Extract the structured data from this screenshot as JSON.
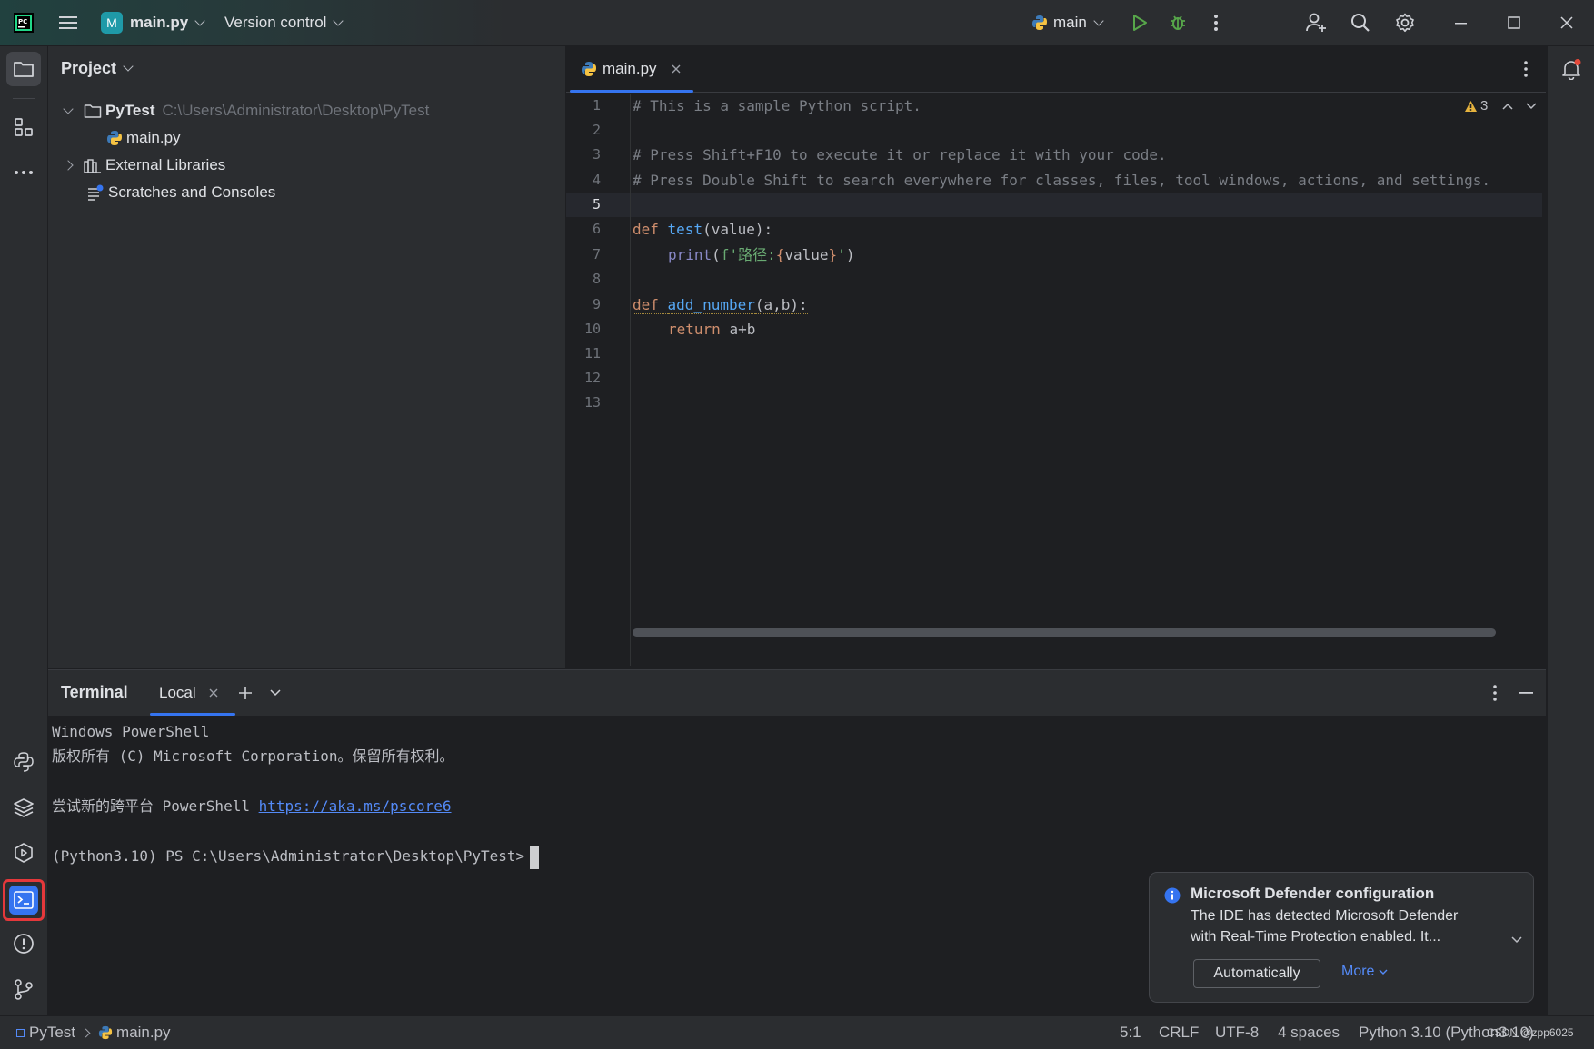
{
  "titlebar": {
    "project_badge": "M",
    "project_name": "main.py",
    "vcs_label": "Version control",
    "run_config": "main"
  },
  "project_panel": {
    "title": "Project",
    "tree": [
      {
        "label": "PyTest",
        "path": "C:\\Users\\Administrator\\Desktop\\PyTest"
      },
      {
        "label": "main.py"
      },
      {
        "label": "External Libraries"
      },
      {
        "label": "Scratches and Consoles"
      }
    ]
  },
  "editor": {
    "tab_label": "main.py",
    "warning_count": "3",
    "line_numbers": [
      "1",
      "2",
      "3",
      "4",
      "5",
      "6",
      "7",
      "8",
      "9",
      "10",
      "11",
      "12",
      "13"
    ],
    "lines": {
      "l1": "# This is a sample Python script.",
      "l3": "# Press Shift+F10 to execute it or replace it with your code.",
      "l4": "# Press Double Shift to search everywhere for classes, files, tool windows, actions, and settings.",
      "l6_kw": "def ",
      "l6_fn": "test",
      "l6_rest": "(value):",
      "l7_fn": "print",
      "l7_open": "(",
      "l7_str1": "f'路径:",
      "l7_brace_open": "{",
      "l7_var": "value",
      "l7_brace_close": "}",
      "l7_str2": "'",
      "l7_close": ")",
      "l9_kw": "def ",
      "l9_fn": "add_number",
      "l9_rest": "(a,b):",
      "l10_kw": "return ",
      "l10_rest": "a+b"
    }
  },
  "terminal": {
    "title": "Terminal",
    "tab_label": "Local",
    "lines": [
      "Windows PowerShell",
      "版权所有 (C) Microsoft Corporation。保留所有权利。",
      "尝试新的跨平台 PowerShell ",
      "(Python3.10) PS C:\\Users\\Administrator\\Desktop\\PyTest>"
    ],
    "link": "https://aka.ms/pscore6"
  },
  "notification": {
    "title": "Microsoft Defender configuration",
    "body_line1": "The IDE has detected Microsoft Defender",
    "body_line2": "with Real-Time Protection enabled. It...",
    "button_label": "Automatically",
    "more_label": "More"
  },
  "statusbar": {
    "crumb_project": "PyTest",
    "crumb_file": "main.py",
    "caret": "5:1",
    "line_sep": "CRLF",
    "encoding": "UTF-8",
    "indent": "4 spaces",
    "interpreter": "Python 3.10 (Python3.10)",
    "watermark": "CSDN @zpp6025"
  },
  "colors": {
    "accent": "#3574f0",
    "highlight_box": "#e5383b",
    "keyword": "#cf8e6d",
    "function": "#56a8f5",
    "comment": "#7a7e85",
    "string": "#6aab73"
  }
}
